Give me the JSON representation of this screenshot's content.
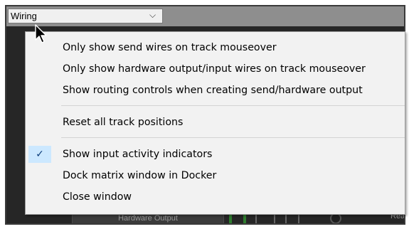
{
  "combo": {
    "value": "Wiring",
    "arrow_icon": "chevron-down-icon"
  },
  "menu": {
    "items": [
      {
        "label": "Only show send wires on track mouseover",
        "checked": false
      },
      {
        "label": "Only show hardware output/input wires on track mouseover",
        "checked": false
      },
      {
        "label": "Show routing controls when creating send/hardware output",
        "checked": false
      },
      {
        "label": "Reset all track positions",
        "checked": false
      },
      {
        "label": "Show input activity indicators",
        "checked": true
      },
      {
        "label": "Dock matrix window in Docker",
        "checked": false
      },
      {
        "label": "Close window",
        "checked": false
      }
    ],
    "check_glyph": "✓"
  },
  "background": {
    "hardware_output_label": "Hardware Output",
    "rea_label": "Rea"
  },
  "colors": {
    "menu_bg": "#f2f2f2",
    "check_highlight": "#cce8ff",
    "toolbar": "#8e8e8e",
    "panel": "#262626"
  }
}
